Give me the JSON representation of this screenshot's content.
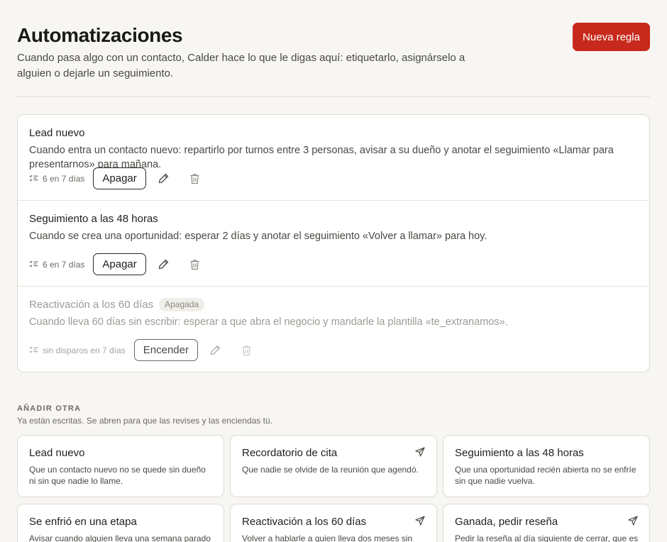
{
  "header": {
    "title": "Automatizaciones",
    "subtitle": "Cuando pasa algo con un contacto, Calder hace lo que le digas aquí: etiquetarlo, asignárselo a alguien o dejarle un seguimiento.",
    "new_rule_label": "Nueva regla"
  },
  "rules": [
    {
      "title": "Lead nuevo",
      "desc": "Cuando entra un contacto nuevo: repartirlo por turnos entre 3 personas, avisar a su dueño y anotar el seguimiento «Llamar para presentarnos» para mañana.",
      "stat": "6 en 7 días",
      "toggle_label": "Apagar",
      "badge": ""
    },
    {
      "title": "Seguimiento a las 48 horas",
      "desc": "Cuando se crea una oportunidad: esperar 2 días y anotar el seguimiento «Volver a llamar» para hoy.",
      "stat": "6 en 7 días",
      "toggle_label": "Apagar",
      "badge": ""
    },
    {
      "title": "Reactivación a los 60 días",
      "desc": "Cuando lleva 60 días sin escribir: esperar a que abra el negocio y mandarle la plantilla «te_extranamos».",
      "stat": "sin disparos en 7 días",
      "toggle_label": "Encender",
      "badge": "Apagada"
    }
  ],
  "add_section": {
    "label": "AÑADIR OTRA",
    "sub": "Ya están escritas. Se abren para que las revises y las enciendas tú."
  },
  "templates": [
    {
      "title": "Lead nuevo",
      "desc": "Que un contacto nuevo no se quede sin dueño ni sin que nadie lo llame.",
      "icon": ""
    },
    {
      "title": "Recordatorio de cita",
      "desc": "Que nadie se olvide de la reunión que agendó.",
      "icon": "send-icon"
    },
    {
      "title": "Seguimiento a las 48 horas",
      "desc": "Que una oportunidad recién abierta no se enfríe sin que nadie vuelva.",
      "icon": ""
    },
    {
      "title": "Se enfrió en una etapa",
      "desc": "Avisar cuando alguien lleva una semana parado",
      "icon": ""
    },
    {
      "title": "Reactivación a los 60 días",
      "desc": "Volver a hablarle a quien lleva dos meses sin",
      "icon": "send-icon"
    },
    {
      "title": "Ganada, pedir reseña",
      "desc": "Pedir la reseña al día siguiente de cerrar, que es",
      "icon": "send-icon"
    }
  ],
  "colors": {
    "accent": "#c72a1c",
    "background": "#f7f6f2",
    "card": "#ffffff",
    "border": "#dedbd3"
  }
}
